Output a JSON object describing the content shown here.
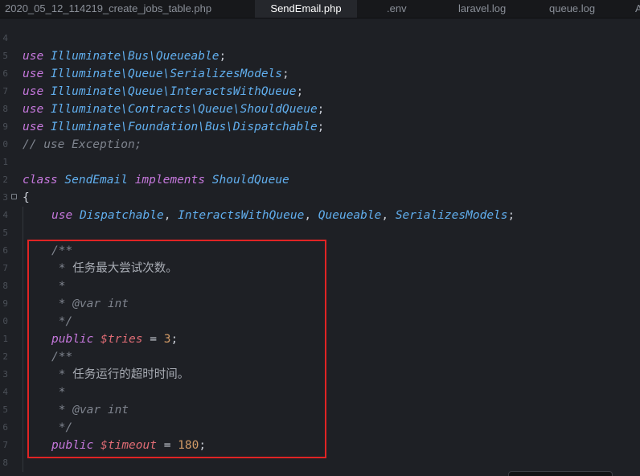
{
  "tabs": [
    {
      "label": "2020_05_12_114219_create_jobs_table.php",
      "active": false
    },
    {
      "label": "SendEmail.php",
      "active": true
    },
    {
      "label": ".env",
      "active": false
    },
    {
      "label": "laravel.log",
      "active": false
    },
    {
      "label": "queue.log",
      "active": false
    },
    {
      "label": "A",
      "active": false
    }
  ],
  "lines": [
    {
      "n": "4"
    },
    {
      "n": "5",
      "parts": [
        "use",
        "Illuminate\\Bus\\Queueable",
        ";"
      ]
    },
    {
      "n": "6",
      "parts": [
        "use",
        "Illuminate\\Queue\\SerializesModels",
        ";"
      ]
    },
    {
      "n": "7",
      "parts": [
        "use",
        "Illuminate\\Queue\\InteractsWithQueue",
        ";"
      ]
    },
    {
      "n": "8",
      "parts": [
        "use",
        "Illuminate\\Contracts\\Queue\\ShouldQueue",
        ";"
      ]
    },
    {
      "n": "9",
      "parts": [
        "use",
        "Illuminate\\Foundation\\Bus\\Dispatchable",
        ";"
      ]
    },
    {
      "n": "0",
      "comment": "// use Exception;"
    },
    {
      "n": "1"
    },
    {
      "n": "2",
      "class_line": [
        "class",
        "SendEmail",
        "implements",
        "ShouldQueue"
      ]
    },
    {
      "n": "3",
      "brace": "{"
    },
    {
      "n": "4",
      "trait_line": [
        "use",
        "Dispatchable",
        "InteractsWithQueue",
        "Queueable",
        "SerializesModels"
      ]
    },
    {
      "n": "5"
    },
    {
      "n": "6",
      "comment": "/**"
    },
    {
      "n": "7",
      "comment_star": " * ",
      "comment_text": "任务最大尝试次数。"
    },
    {
      "n": "8",
      "comment": " *"
    },
    {
      "n": "9",
      "comment": " * @var int"
    },
    {
      "n": "0",
      "comment": " */"
    },
    {
      "n": "1",
      "prop": [
        "public",
        "$tries",
        "=",
        "3",
        ";"
      ]
    },
    {
      "n": "2",
      "comment": "/**"
    },
    {
      "n": "3",
      "comment_star": " * ",
      "comment_text": "任务运行的超时时间。"
    },
    {
      "n": "4",
      "comment": " *"
    },
    {
      "n": "5",
      "comment": " * @var int"
    },
    {
      "n": "6",
      "comment": " */"
    },
    {
      "n": "7",
      "prop": [
        "public",
        "$timeout",
        "=",
        "180",
        ";"
      ]
    },
    {
      "n": "8"
    }
  ]
}
